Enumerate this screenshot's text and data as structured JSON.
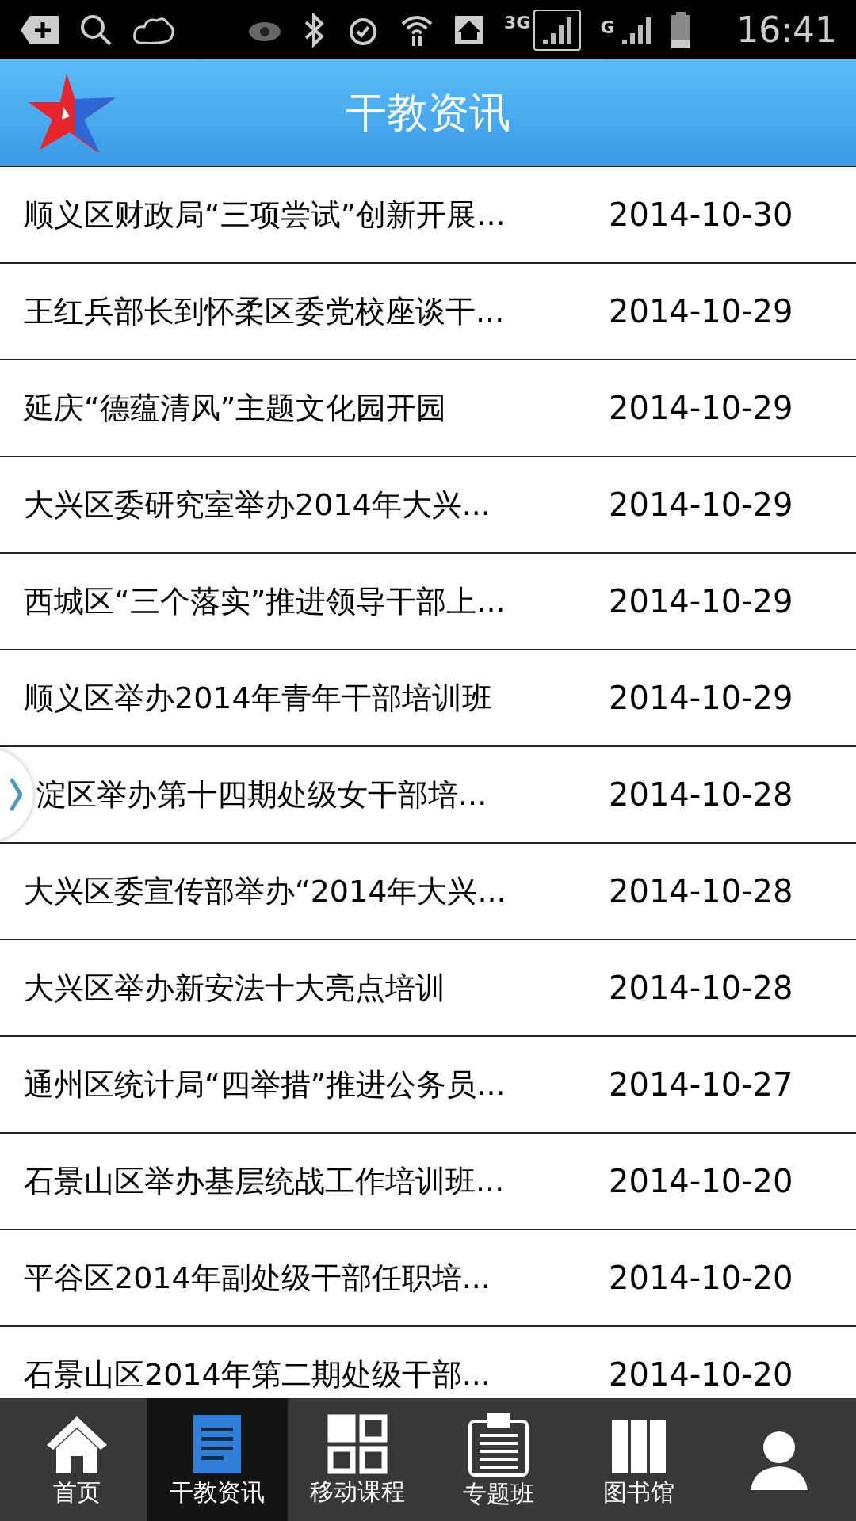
{
  "status_bar": {
    "time": "16:41",
    "network_1": "3G",
    "network_2": "G"
  },
  "header": {
    "title": "干教资讯"
  },
  "news": [
    {
      "title": "顺义区财政局“三项尝试”创新开展...",
      "date": "2014-10-30"
    },
    {
      "title": "王红兵部长到怀柔区委党校座谈干...",
      "date": "2014-10-29"
    },
    {
      "title": "延庆“德蕴清风”主题文化园开园",
      "date": "2014-10-29"
    },
    {
      "title": "大兴区委研究室举办2014年大兴...",
      "date": "2014-10-29"
    },
    {
      "title": "西城区“三个落实”推进领导干部上...",
      "date": "2014-10-29"
    },
    {
      "title": "顺义区举办2014年青年干部培训班",
      "date": "2014-10-29"
    },
    {
      "title": "淀区举办第十四期处级女干部培...",
      "date": "2014-10-28"
    },
    {
      "title": "大兴区委宣传部举办“2014年大兴...",
      "date": "2014-10-28"
    },
    {
      "title": "大兴区举办新安法十大亮点培训",
      "date": "2014-10-28"
    },
    {
      "title": "通州区统计局“四举措”推进公务员...",
      "date": "2014-10-27"
    },
    {
      "title": "石景山区举办基层统战工作培训班...",
      "date": "2014-10-20"
    },
    {
      "title": "平谷区2014年副处级干部任职培...",
      "date": "2014-10-20"
    },
    {
      "title": "石景山区2014年第二期处级干部...",
      "date": "2014-10-20"
    }
  ],
  "tabs": [
    {
      "kind": "home",
      "label": "首页",
      "selected": false
    },
    {
      "kind": "news",
      "label": "干教资讯",
      "selected": true
    },
    {
      "kind": "grid",
      "label": "移动课程",
      "selected": false
    },
    {
      "kind": "clipboard",
      "label": "专题班",
      "selected": false
    },
    {
      "kind": "books",
      "label": "图书馆",
      "selected": false
    },
    {
      "kind": "person",
      "selected": false
    }
  ]
}
